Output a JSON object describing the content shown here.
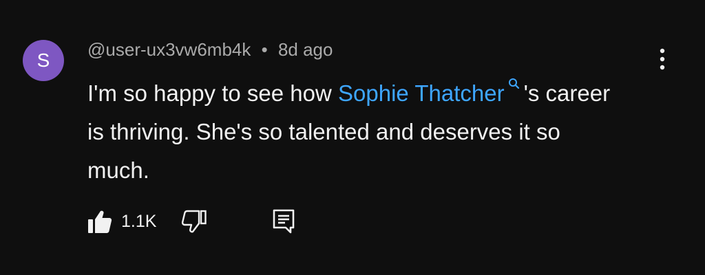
{
  "comment": {
    "avatar_letter": "S",
    "avatar_color": "#7e57c2",
    "author": "@user-ux3vw6mb4k",
    "separator": "•",
    "time": "8d ago",
    "text_before": "I'm so happy to see how ",
    "mention": "Sophie Thatcher",
    "text_after": "'s career is thriving. She's so talented and deserves it so much.",
    "mention_color": "#3ea6ff",
    "like_count": "1.1K"
  },
  "icons": {
    "more": "more-vertical-icon",
    "like": "thumbs-up-filled-icon",
    "dislike": "thumbs-down-outline-icon",
    "reply": "comment-reply-icon",
    "search": "search-icon"
  }
}
